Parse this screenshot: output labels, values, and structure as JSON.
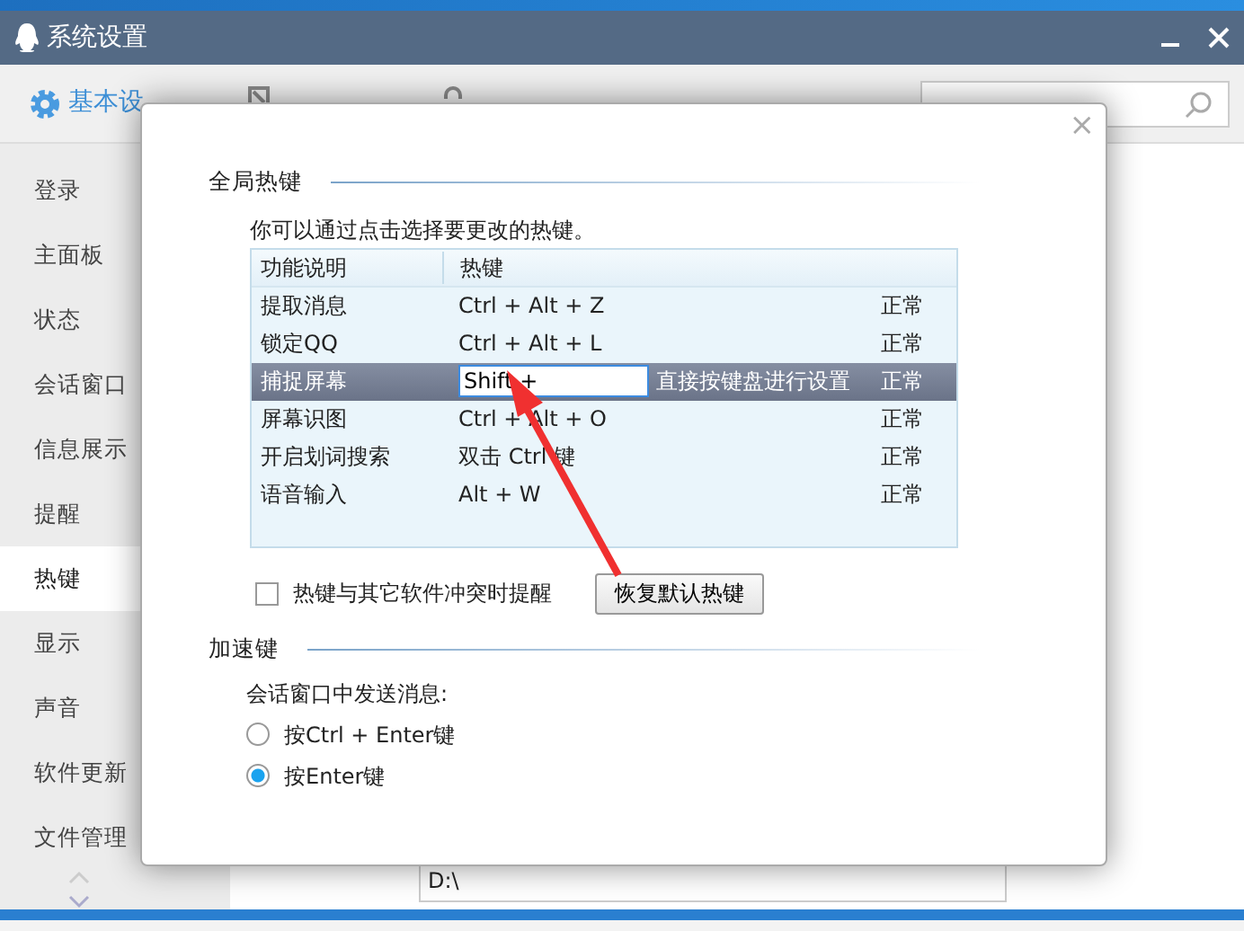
{
  "window": {
    "title": "系统设置"
  },
  "tabs": [
    {
      "label": "基本设",
      "selected": true
    },
    {
      "selected": false
    },
    {
      "selected": false
    }
  ],
  "sidebar": {
    "items": [
      {
        "label": "登录",
        "selected": false
      },
      {
        "label": "主面板",
        "selected": false
      },
      {
        "label": "状态",
        "selected": false
      },
      {
        "label": "会话窗口",
        "selected": false
      },
      {
        "label": "信息展示",
        "selected": false
      },
      {
        "label": "提醒",
        "selected": false
      },
      {
        "label": "热键",
        "selected": true
      },
      {
        "label": "显示",
        "selected": false
      },
      {
        "label": "声音",
        "selected": false
      },
      {
        "label": "软件更新",
        "selected": false
      },
      {
        "label": "文件管理",
        "selected": false
      }
    ]
  },
  "background": {
    "path_value": "D:\\"
  },
  "dialog": {
    "close": "×",
    "global_hotkeys": {
      "heading": "全局热键",
      "hint": "你可以通过点击选择要更改的热键。",
      "columns": [
        "功能说明",
        "热键"
      ],
      "rows": [
        {
          "function": "提取消息",
          "hotkey": "Ctrl + Alt + Z",
          "status": "正常",
          "selected": false
        },
        {
          "function": "锁定QQ",
          "hotkey": "Ctrl + Alt + L",
          "status": "正常",
          "selected": false
        },
        {
          "function": "捕捉屏幕",
          "hotkey": "Shift +",
          "note": "直接按键盘进行设置",
          "status": "正常",
          "selected": true
        },
        {
          "function": "屏幕识图",
          "hotkey": "Ctrl + Alt + O",
          "status": "正常",
          "selected": false
        },
        {
          "function": "开启划词搜索",
          "hotkey": "双击 Ctrl 键",
          "status": "正常",
          "selected": false
        },
        {
          "function": "语音输入",
          "hotkey": "Alt + W",
          "status": "正常",
          "selected": false
        }
      ],
      "conflict_alert": {
        "label": "热键与其它软件冲突时提醒",
        "checked": false
      },
      "restore_button": "恢复默认热键"
    },
    "accelerator": {
      "heading": "加速键",
      "prompt": "会话窗口中发送消息:",
      "options": [
        {
          "label": "按Ctrl + Enter键",
          "selected": false
        },
        {
          "label": "按Enter键",
          "selected": true
        }
      ]
    }
  }
}
